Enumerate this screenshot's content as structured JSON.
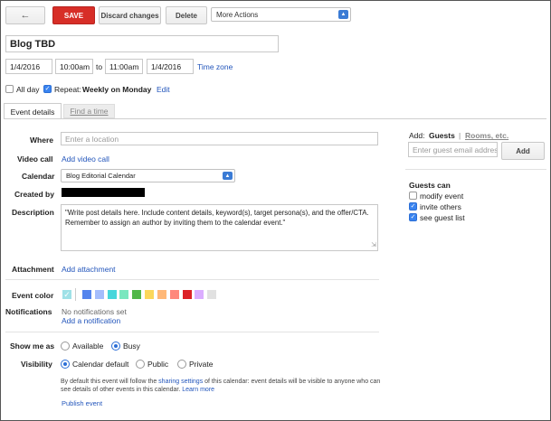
{
  "toolbar": {
    "back_icon": "arrow-left-icon",
    "save_label": "SAVE",
    "discard_label": "Discard changes",
    "delete_label": "Delete",
    "more_actions_label": "More Actions"
  },
  "event": {
    "title": "Blog TBD",
    "start_date": "1/4/2016",
    "start_time": "10:00am",
    "to_label": "to",
    "end_time": "11:00am",
    "end_date": "1/4/2016",
    "timezone_link": "Time zone",
    "all_day_label": "All day",
    "repeat_label": "Repeat:",
    "repeat_value": "Weekly on Monday",
    "repeat_edit": "Edit"
  },
  "tabs": [
    {
      "label": "Event details",
      "active": true
    },
    {
      "label": "Find a time",
      "active": false
    }
  ],
  "details": {
    "where_label": "Where",
    "where_placeholder": "Enter a location",
    "video_label": "Video call",
    "video_link": "Add video call",
    "calendar_label": "Calendar",
    "calendar_value": "Blog Editorial Calendar",
    "created_by_label": "Created by",
    "description_label": "Description",
    "description_value": "\"Write post details here. Include content details, keyword(s), target persona(s), and the offer/CTA. Remember to assign an author by inviting them to the calendar event.\"",
    "attachment_label": "Attachment",
    "attachment_link": "Add attachment",
    "event_color_label": "Event color",
    "colors": [
      "#9fe1e7",
      "#5484ed",
      "#a4bdfc",
      "#46d6db",
      "#7ae7bf",
      "#51b749",
      "#fbd75b",
      "#ffb878",
      "#ff887c",
      "#dc2127",
      "#dbadff",
      "#e1e1e1"
    ],
    "notifications_label": "Notifications",
    "notifications_none": "No notifications set",
    "notifications_add": "Add a notification",
    "show_me_as_label": "Show me as",
    "show_available": "Available",
    "show_busy": "Busy",
    "visibility_label": "Visibility",
    "visibility_default": "Calendar default",
    "visibility_public": "Public",
    "visibility_private": "Private",
    "visibility_note_1": "By default this event will follow the ",
    "visibility_note_link": "sharing settings",
    "visibility_note_2": " of this calendar: event details will be visible to anyone who can see details of other events in this calendar. ",
    "visibility_learn_more": "Learn more",
    "publish_link": "Publish event"
  },
  "guests": {
    "add_label": "Add:",
    "guests_tab": "Guests",
    "separator": "|",
    "rooms_tab": "Rooms, etc.",
    "email_placeholder": "Enter guest email addres",
    "add_button": "Add",
    "can_label": "Guests can",
    "permissions": [
      {
        "label": "modify event",
        "checked": false
      },
      {
        "label": "invite others",
        "checked": true
      },
      {
        "label": "see guest list",
        "checked": true
      }
    ]
  }
}
